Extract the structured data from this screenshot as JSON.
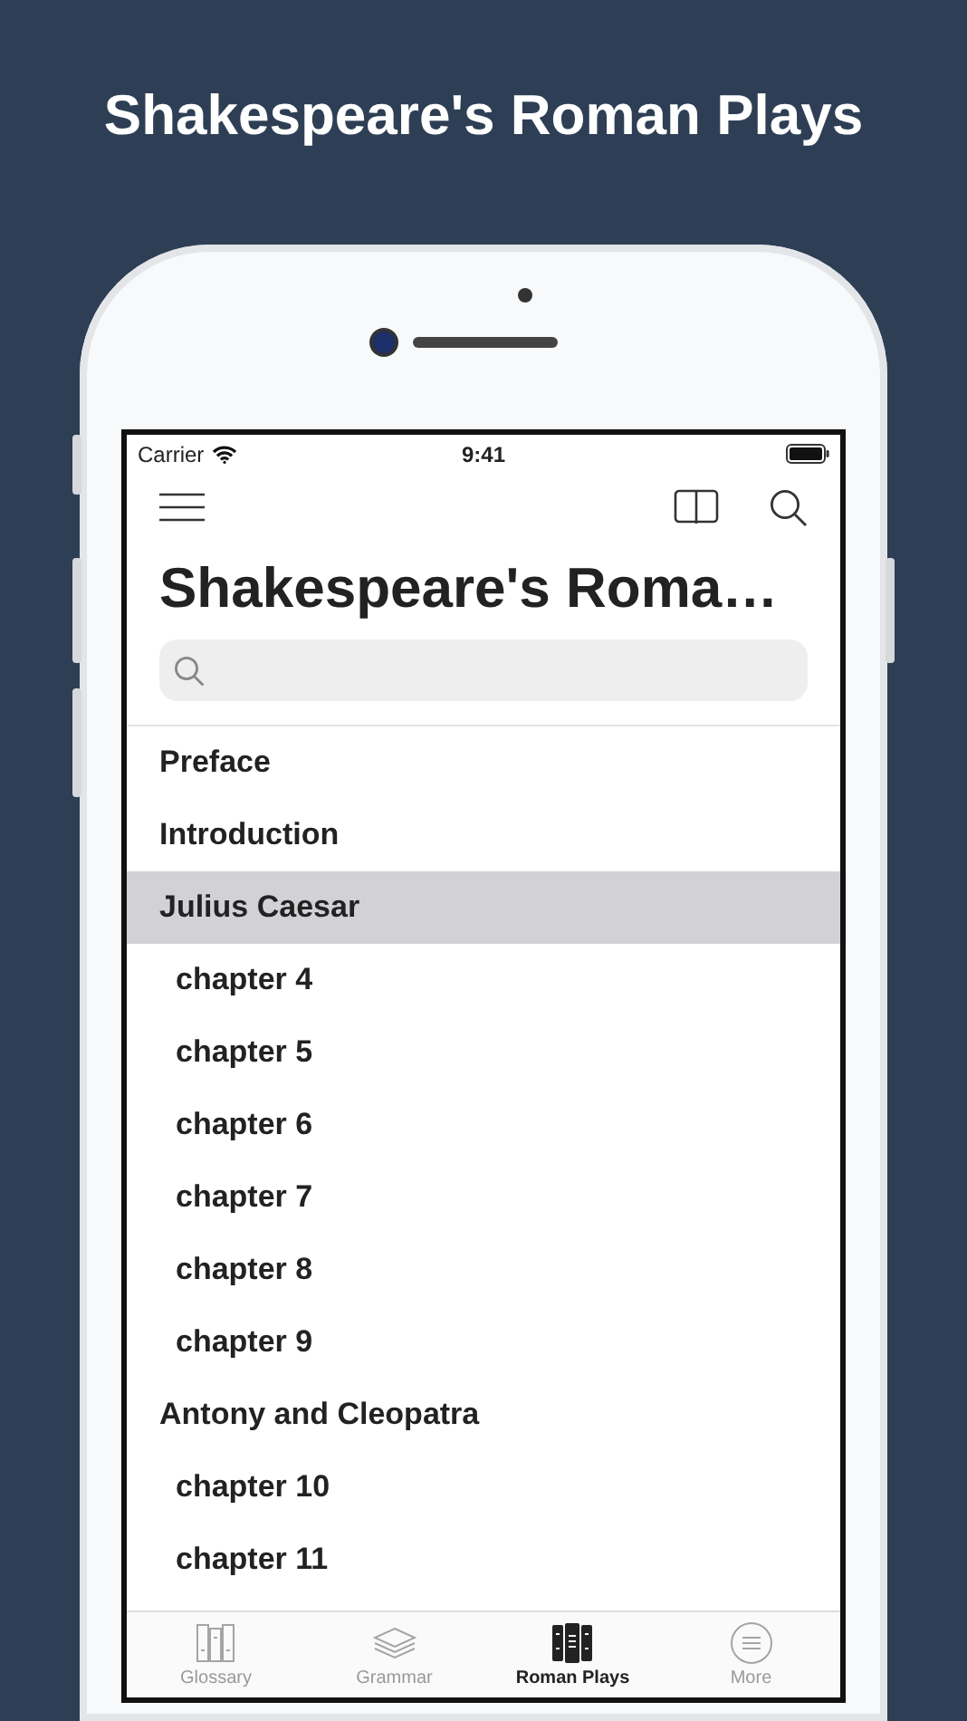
{
  "headline": "Shakespeare's Roman Plays",
  "status_bar": {
    "carrier": "Carrier",
    "time": "9:41"
  },
  "title": "Shakespeare's Roma…",
  "list": [
    {
      "label": "Preface",
      "kind": "section",
      "selected": false
    },
    {
      "label": "Introduction",
      "kind": "section",
      "selected": false
    },
    {
      "label": "Julius Caesar",
      "kind": "section",
      "selected": true
    },
    {
      "label": "chapter 4",
      "kind": "chapter",
      "selected": false
    },
    {
      "label": "chapter 5",
      "kind": "chapter",
      "selected": false
    },
    {
      "label": "chapter 6",
      "kind": "chapter",
      "selected": false
    },
    {
      "label": "chapter 7",
      "kind": "chapter",
      "selected": false
    },
    {
      "label": "chapter 8",
      "kind": "chapter",
      "selected": false
    },
    {
      "label": "chapter 9",
      "kind": "chapter",
      "selected": false
    },
    {
      "label": "Antony and Cleopatra",
      "kind": "section",
      "selected": false
    },
    {
      "label": "chapter 10",
      "kind": "chapter",
      "selected": false
    },
    {
      "label": "chapter 11",
      "kind": "chapter",
      "selected": false
    }
  ],
  "tabs": [
    {
      "label": "Glossary",
      "kind": "glossary",
      "selected": false
    },
    {
      "label": "Grammar",
      "kind": "grammar",
      "selected": false
    },
    {
      "label": "Roman Plays",
      "kind": "plays",
      "selected": true
    },
    {
      "label": "More",
      "kind": "more",
      "selected": false
    }
  ]
}
